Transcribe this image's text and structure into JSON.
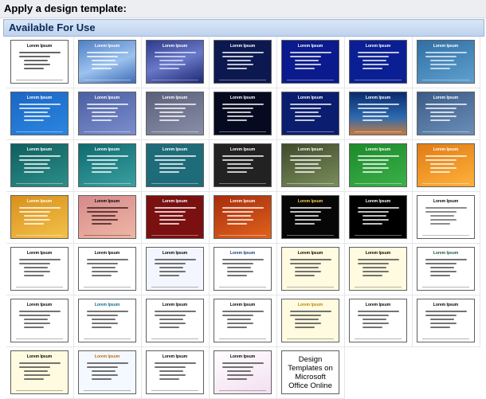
{
  "pane": {
    "heading": "Apply a design template:",
    "section_title": "Available For Use"
  },
  "templates": [
    {
      "title": "Lorem Ipsum",
      "bg": "#ffffff",
      "fg": "#000000",
      "line": "#333333"
    },
    {
      "title": "Lorem Ipsum",
      "bg": "linear-gradient(160deg,#4f7fc6,#9cc2ee 55%,#3f6db8)",
      "fg": "#ffffff",
      "line": "#ffffff"
    },
    {
      "title": "Lorem Ipsum",
      "bg": "linear-gradient(160deg,#2d3b8c,#6a78c8 50%,#1d2a73)",
      "fg": "#ffffff",
      "line": "#dfe3ff"
    },
    {
      "title": "Lorem Ipsum",
      "bg": "#0c1850",
      "fg": "#ffffff",
      "line": "#ffffff"
    },
    {
      "title": "Lorem Ipsum",
      "bg": "#0b1a8c",
      "fg": "#ffffff",
      "line": "#ffffff"
    },
    {
      "title": "Lorem Ipsum",
      "bg": "#0a1f94",
      "fg": "#ffffff",
      "line": "#ffffff"
    },
    {
      "title": "Lorem Ipsum",
      "bg": "linear-gradient(160deg,#2f6fa3,#5fa0cf)",
      "fg": "#ffffff",
      "line": "#e8f2ff"
    },
    {
      "title": "Lorem Ipsum",
      "bg": "linear-gradient(160deg,#1b66c5,#2b86e0)",
      "fg": "#ffffff",
      "line": "#ffffff"
    },
    {
      "title": "Lorem Ipsum",
      "bg": "linear-gradient(160deg,#4a5fa4,#7b8dcc)",
      "fg": "#ffffff",
      "line": "#ffffff"
    },
    {
      "title": "Lorem Ipsum",
      "bg": "linear-gradient(160deg,#5a5f7a,#8a8fa8)",
      "fg": "#ffffff",
      "line": "#ffffff"
    },
    {
      "title": "Lorem Ipsum",
      "bg": "#050a20",
      "fg": "#ffffff",
      "line": "#ffffff"
    },
    {
      "title": "Lorem Ipsum",
      "bg": "#0b1d6e",
      "fg": "#ffffff",
      "line": "#ffffff"
    },
    {
      "title": "Lorem Ipsum",
      "bg": "linear-gradient(180deg,#0a2a6e,#2e6bb0 60%,#c87a3a)",
      "fg": "#ffffff",
      "line": "#ffffff"
    },
    {
      "title": "Lorem Ipsum",
      "bg": "linear-gradient(160deg,#3a5a86,#6b8fb8)",
      "fg": "#ffffff",
      "line": "#ffffff"
    },
    {
      "title": "Lorem Ipsum",
      "bg": "linear-gradient(160deg,#0f5e5e,#2c8f8a)",
      "fg": "#ffffff",
      "line": "#ffffff"
    },
    {
      "title": "Lorem Ipsum",
      "bg": "linear-gradient(160deg,#0e6a6f,#3aa0a0)",
      "fg": "#ffffff",
      "line": "#ffffff"
    },
    {
      "title": "Lorem Ipsum",
      "bg": "#1e6c7a",
      "fg": "#ffffff",
      "line": "#ffffff"
    },
    {
      "title": "Lorem Ipsum",
      "bg": "#222222",
      "fg": "#ffffff",
      "line": "#ffffff"
    },
    {
      "title": "Lorem Ipsum",
      "bg": "linear-gradient(160deg,#3e4a2a,#7b8e5c)",
      "fg": "#ffffff",
      "line": "#ffffff"
    },
    {
      "title": "Lorem Ipsum",
      "bg": "linear-gradient(160deg,#1c8a2a,#3bb04a)",
      "fg": "#ffffff",
      "line": "#ffffff"
    },
    {
      "title": "Lorem Ipsum",
      "bg": "linear-gradient(160deg,#e07b14,#ffb23c)",
      "fg": "#ffffff",
      "line": "#ffffff"
    },
    {
      "title": "Lorem Ipsum",
      "bg": "linear-gradient(160deg,#d8901a,#f3c14a)",
      "fg": "#ffffff",
      "line": "#ffffff"
    },
    {
      "title": "Lorem Ipsum",
      "bg": "linear-gradient(160deg,#d58a8a,#f0b7a6)",
      "fg": "#000000",
      "line": "#3a1a1a"
    },
    {
      "title": "Lorem Ipsum",
      "bg": "#7a1010",
      "fg": "#ffffff",
      "line": "#ffffff"
    },
    {
      "title": "Lorem Ipsum",
      "bg": "linear-gradient(160deg,#a82c0c,#e0631c)",
      "fg": "#ffffff",
      "line": "#ffffff"
    },
    {
      "title": "Lorem Ipsum",
      "bg": "#070707",
      "fg": "#ffd64a",
      "line": "#ffffff"
    },
    {
      "title": "Lorem Ipsum",
      "bg": "#000000",
      "fg": "#ffffff",
      "line": "#ffffff"
    },
    {
      "title": "Lorem Ipsum",
      "bg": "#ffffff",
      "fg": "#000000",
      "line": "#666666"
    },
    {
      "title": "Lorem Ipsum",
      "bg": "#ffffff",
      "fg": "#000000",
      "line": "#444444"
    },
    {
      "title": "Lorem Ipsum",
      "bg": "#ffffff",
      "fg": "#000000",
      "line": "#444444"
    },
    {
      "title": "Lorem Ipsum",
      "bg": "#f4f6ff",
      "fg": "#000000",
      "line": "#444444"
    },
    {
      "title": "Lorem Ipsum",
      "bg": "#ffffff",
      "fg": "#1a3a7a",
      "line": "#444444"
    },
    {
      "title": "Lorem Ipsum",
      "bg": "#fffbe0",
      "fg": "#000000",
      "line": "#444444"
    },
    {
      "title": "Lorem Ipsum",
      "bg": "#fffbe0",
      "fg": "#000000",
      "line": "#444444"
    },
    {
      "title": "Lorem Ipsum",
      "bg": "#ffffff",
      "fg": "#1a5a3a",
      "line": "#444444"
    },
    {
      "title": "Lorem Ipsum",
      "bg": "#ffffff",
      "fg": "#000000",
      "line": "#444444"
    },
    {
      "title": "Lorem Ipsum",
      "bg": "#ffffff",
      "fg": "#0a6b8a",
      "line": "#444444"
    },
    {
      "title": "Lorem Ipsum",
      "bg": "#ffffff",
      "fg": "#000000",
      "line": "#444444"
    },
    {
      "title": "Lorem Ipsum",
      "bg": "#ffffff",
      "fg": "#000000",
      "line": "#444444"
    },
    {
      "title": "Lorem Ipsum",
      "bg": "#fffbe0",
      "fg": "#b8860b",
      "line": "#444444"
    },
    {
      "title": "Lorem Ipsum",
      "bg": "#ffffff",
      "fg": "#000000",
      "line": "#444444"
    },
    {
      "title": "Lorem Ipsum",
      "bg": "#ffffff",
      "fg": "#000000",
      "line": "#444444"
    },
    {
      "title": "Lorem Ipsum",
      "bg": "#fffbe0",
      "fg": "#000000",
      "line": "#444444"
    },
    {
      "title": "Lorem Ipsum",
      "bg": "#f4f8ff",
      "fg": "#c06a10",
      "line": "#444444"
    },
    {
      "title": "Lorem Ipsum",
      "bg": "#ffffff",
      "fg": "#000000",
      "line": "#444444"
    },
    {
      "title": "Lorem Ipsum",
      "bg": "linear-gradient(160deg,#ffffff,#f3dff0)",
      "fg": "#000000",
      "line": "#444444"
    }
  ],
  "online_tile": {
    "label_1": "Design",
    "label_2": "Templates on",
    "label_3": "Microsoft",
    "label_4": "Office Online"
  }
}
